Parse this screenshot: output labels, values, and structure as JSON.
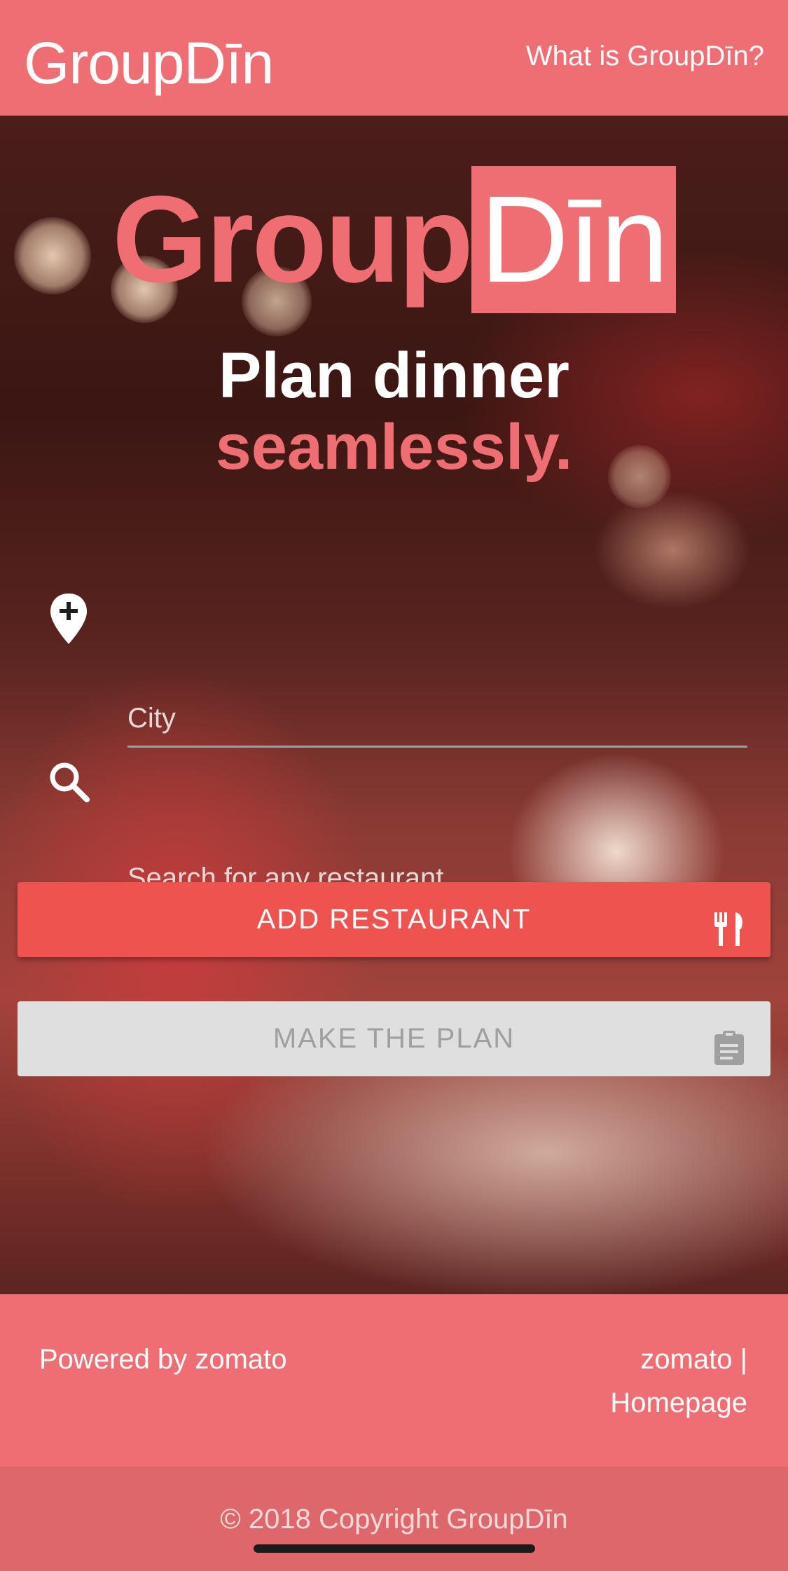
{
  "navbar": {
    "brand": "GroupDīn",
    "link_label": "What is GroupDīn?"
  },
  "hero": {
    "title_part1": "Group",
    "title_part2": "Dīn",
    "tagline_line1": "Plan dinner",
    "tagline_line2": "seamlessly."
  },
  "form": {
    "city_placeholder": "City",
    "city_icon": "map-pin-plus-icon",
    "search_placeholder": "Search for any restaurant",
    "search_icon": "search-icon"
  },
  "buttons": {
    "add_label": "ADD RESTAURANT",
    "add_icon": "cutlery-icon",
    "plan_label": "MAKE THE PLAN",
    "plan_icon": "clipboard-icon"
  },
  "footer": {
    "powered_by": "Powered by zomato",
    "link_line1": "zomato |",
    "link_line2": "Homepage",
    "copyright": "© 2018 Copyright GroupDīn"
  },
  "colors": {
    "brand": "#ee6e73",
    "add_button": "#ef5350",
    "disabled_button": "#dfdfdf",
    "copyright_bar": "#de676b"
  }
}
